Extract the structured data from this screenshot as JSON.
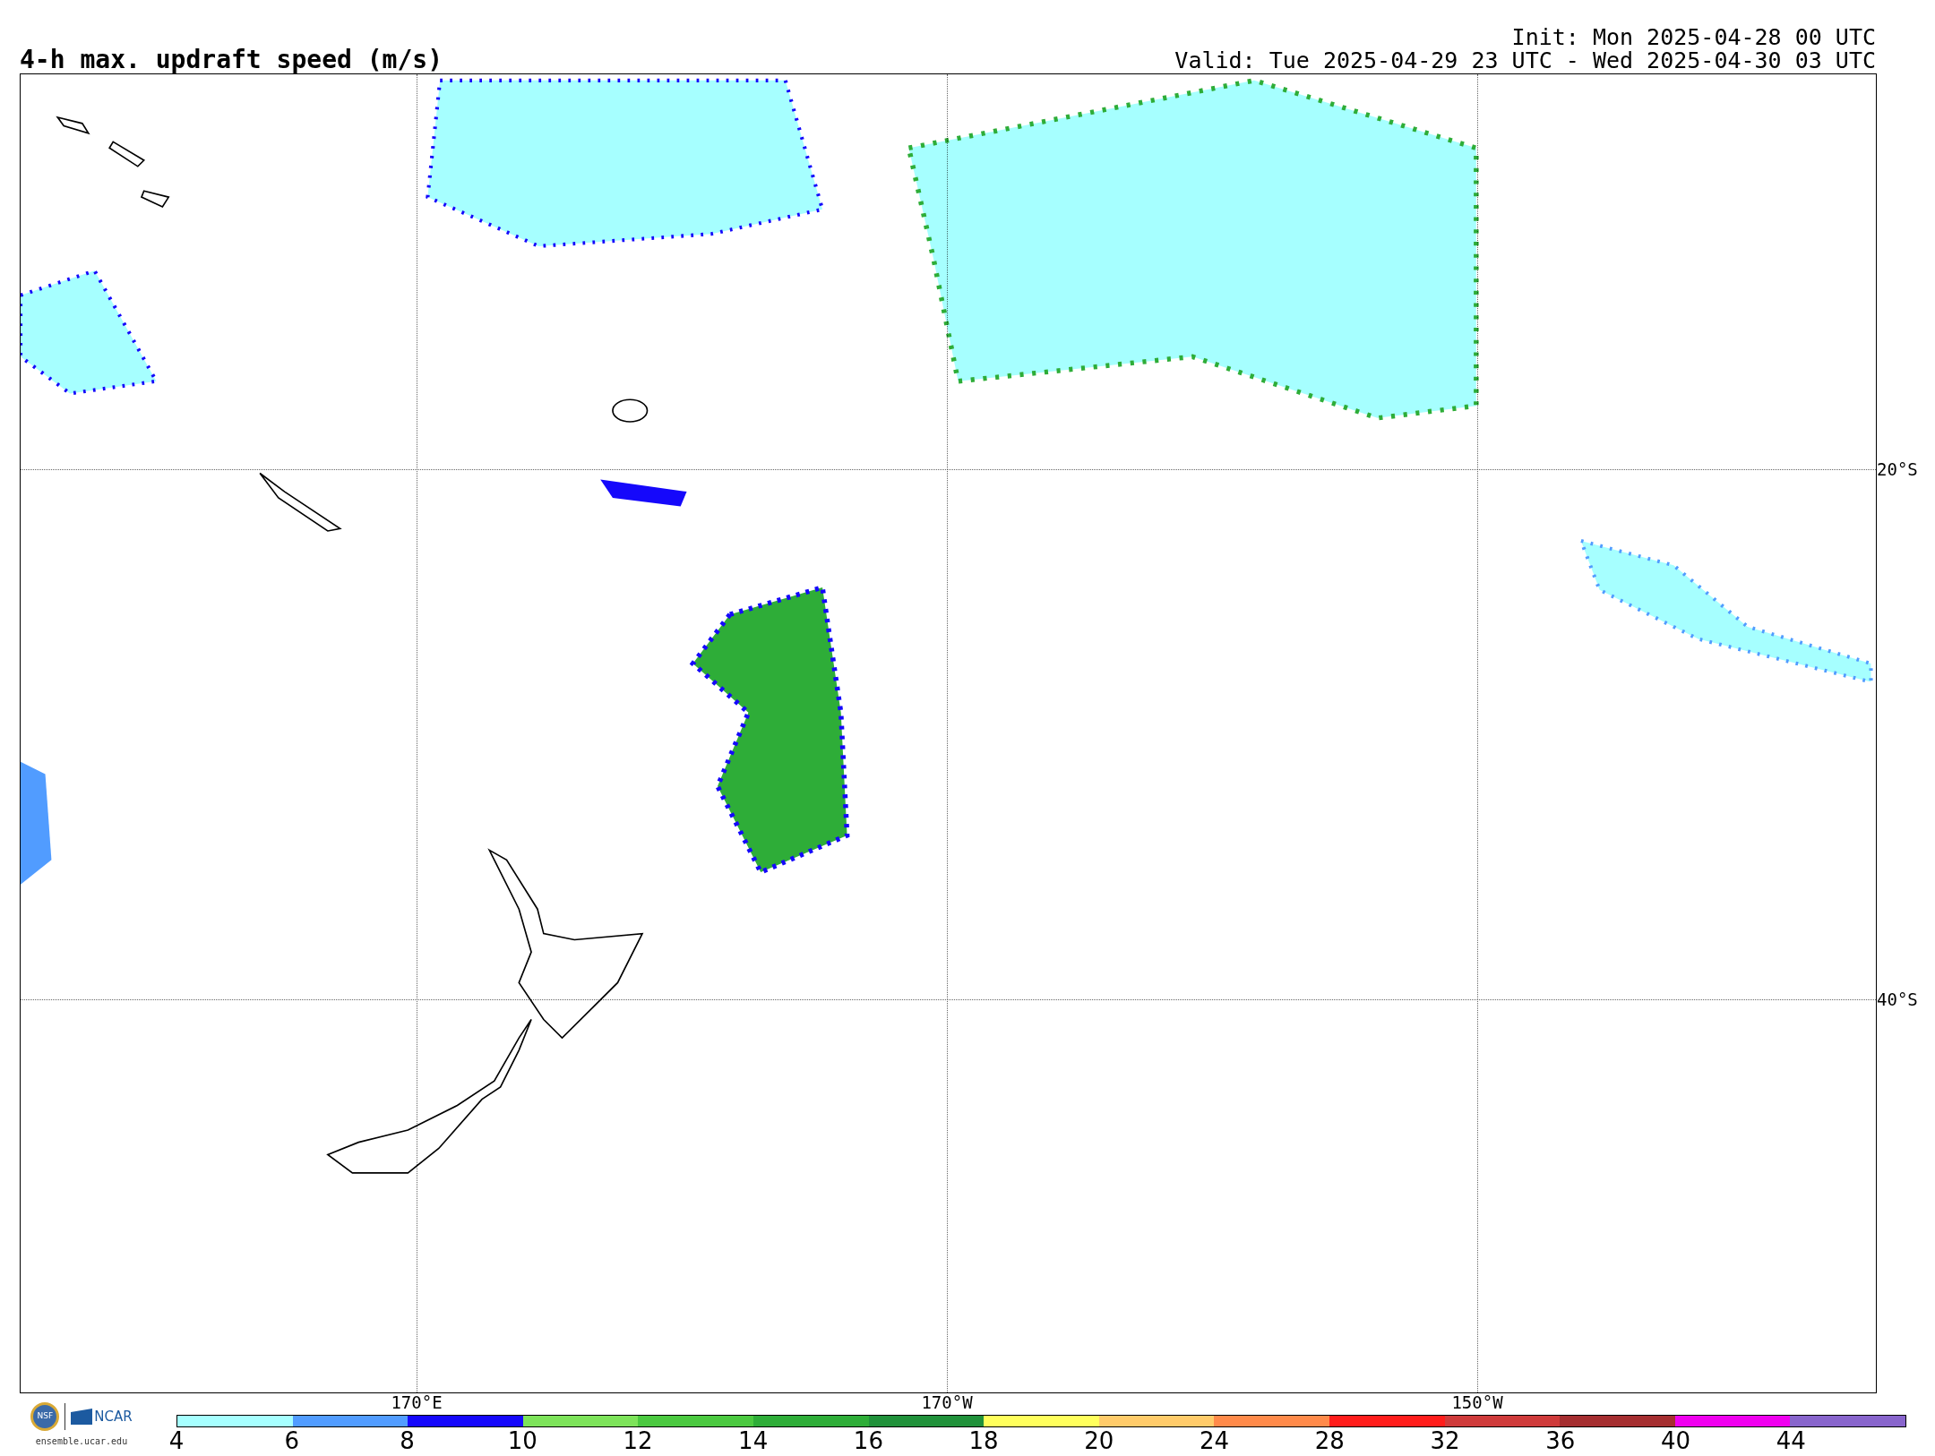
{
  "title": "4-h max. updraft speed (m/s)",
  "init": "Init: Mon 2025-04-28 00 UTC",
  "valid": "Valid: Tue 2025-04-29 23 UTC - Wed 2025-04-30 03 UTC",
  "longitude_labels": [
    "170°E",
    "170°W",
    "150°W"
  ],
  "latitude_labels": [
    "20°S",
    "40°S"
  ],
  "colorbar": {
    "segments": [
      {
        "color": "#a6ffff"
      },
      {
        "color": "#519cff"
      },
      {
        "color": "#1508fb"
      },
      {
        "color": "#7de35a"
      },
      {
        "color": "#4bc940"
      },
      {
        "color": "#2ead38"
      },
      {
        "color": "#20913a"
      },
      {
        "color": "#ffff5c"
      },
      {
        "color": "#ffcb6a"
      },
      {
        "color": "#ff8a4a"
      },
      {
        "color": "#ff1d1b"
      },
      {
        "color": "#cf3b3b"
      },
      {
        "color": "#a52e30"
      },
      {
        "color": "#f000ef"
      },
      {
        "color": "#8865cc"
      }
    ],
    "labels": [
      "4",
      "6",
      "8",
      "10",
      "12",
      "14",
      "16",
      "18",
      "20",
      "24",
      "28",
      "32",
      "36",
      "40",
      "44"
    ]
  },
  "logo": {
    "seal": "NSF",
    "name": "NCAR",
    "url": "ensemble.ucar.edu"
  }
}
